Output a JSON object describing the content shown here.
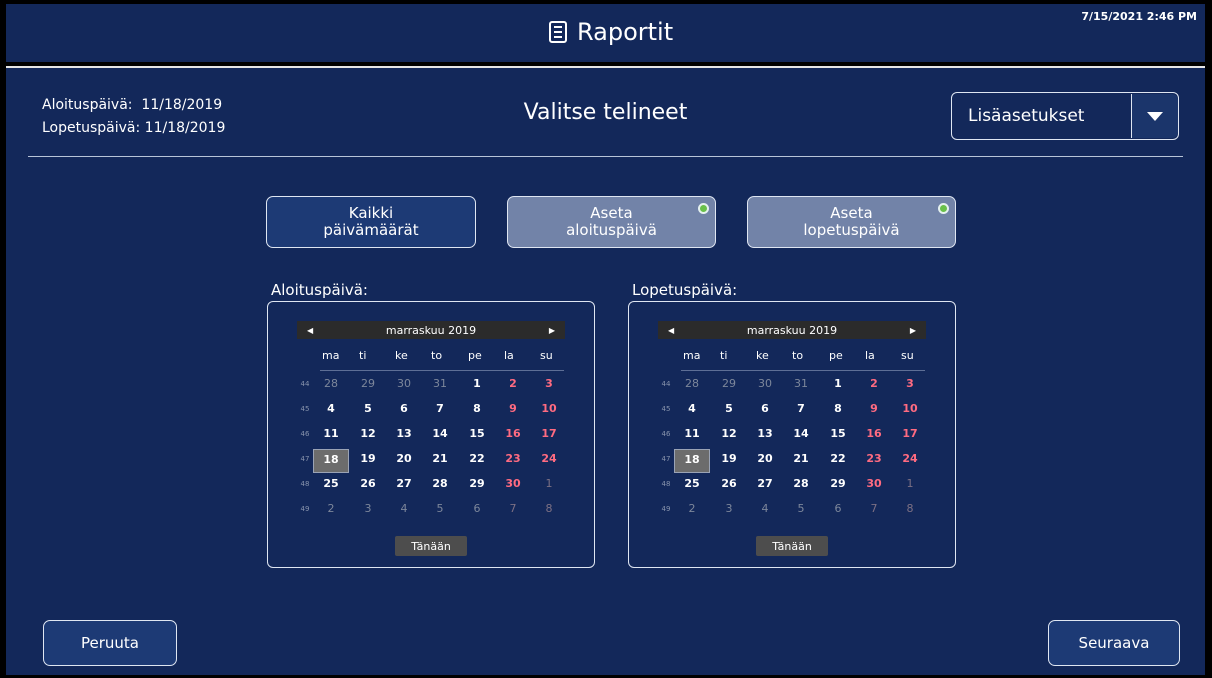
{
  "header": {
    "title": "Raportit",
    "timestamp": "7/15/2021 2:46 PM",
    "icon": "document-icon"
  },
  "summary": {
    "start_label": "Aloituspäivä:",
    "start_value": "11/18/2019",
    "end_label": "Lopetuspäivä:",
    "end_value": "11/18/2019",
    "title": "Valitse telineet"
  },
  "advanced": {
    "label": "Lisäasetukset"
  },
  "date_buttons": {
    "all_line1": "Kaikki",
    "all_line2": "päivämäärät",
    "set_start_line1": "Aseta",
    "set_start_line2": "aloituspäivä",
    "set_end_line1": "Aseta",
    "set_end_line2": "lopetuspäivä"
  },
  "calendars": [
    {
      "label": "Aloituspäivä:",
      "month": "marraskuu 2019",
      "weekdays": [
        "ma",
        "ti",
        "ke",
        "to",
        "pe",
        "la",
        "su"
      ],
      "weeks": [
        {
          "wk": "44",
          "days": [
            "28",
            "29",
            "30",
            "31",
            "1",
            "2",
            "3"
          ]
        },
        {
          "wk": "45",
          "days": [
            "4",
            "5",
            "6",
            "7",
            "8",
            "9",
            "10"
          ]
        },
        {
          "wk": "46",
          "days": [
            "11",
            "12",
            "13",
            "14",
            "15",
            "16",
            "17"
          ]
        },
        {
          "wk": "47",
          "days": [
            "18",
            "19",
            "20",
            "21",
            "22",
            "23",
            "24"
          ]
        },
        {
          "wk": "48",
          "days": [
            "25",
            "26",
            "27",
            "28",
            "29",
            "30",
            "1"
          ]
        },
        {
          "wk": "49",
          "days": [
            "2",
            "3",
            "4",
            "5",
            "6",
            "7",
            "8"
          ]
        }
      ],
      "selected": "18",
      "today_label": "Tänään"
    },
    {
      "label": "Lopetuspäivä:",
      "month": "marraskuu 2019",
      "weekdays": [
        "ma",
        "ti",
        "ke",
        "to",
        "pe",
        "la",
        "su"
      ],
      "weeks": [
        {
          "wk": "44",
          "days": [
            "28",
            "29",
            "30",
            "31",
            "1",
            "2",
            "3"
          ]
        },
        {
          "wk": "45",
          "days": [
            "4",
            "5",
            "6",
            "7",
            "8",
            "9",
            "10"
          ]
        },
        {
          "wk": "46",
          "days": [
            "11",
            "12",
            "13",
            "14",
            "15",
            "16",
            "17"
          ]
        },
        {
          "wk": "47",
          "days": [
            "18",
            "19",
            "20",
            "21",
            "22",
            "23",
            "24"
          ]
        },
        {
          "wk": "48",
          "days": [
            "25",
            "26",
            "27",
            "28",
            "29",
            "30",
            "1"
          ]
        },
        {
          "wk": "49",
          "days": [
            "2",
            "3",
            "4",
            "5",
            "6",
            "7",
            "8"
          ]
        }
      ],
      "selected": "18",
      "today_label": "Tänään"
    }
  ],
  "footer": {
    "cancel": "Peruuta",
    "next": "Seuraava"
  },
  "colors": {
    "background": "#13285a",
    "weekend": "#ff6b81",
    "indicator": "#69c04a"
  }
}
